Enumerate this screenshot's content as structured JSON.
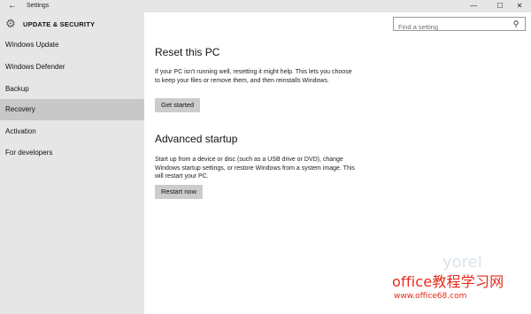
{
  "window": {
    "back_icon": "←",
    "title": "Settings",
    "min_icon": "—",
    "max_icon": "☐",
    "close_icon": "✕"
  },
  "sidebar": {
    "section_title": "UPDATE & SECURITY",
    "gear_icon": "⚙",
    "items": [
      {
        "label": "Windows Update",
        "selected": false
      },
      {
        "label": "Windows Defender",
        "selected": false
      },
      {
        "label": "Backup",
        "selected": false
      },
      {
        "label": "Recovery",
        "selected": true
      },
      {
        "label": "Activation",
        "selected": false
      },
      {
        "label": "For developers",
        "selected": false
      }
    ]
  },
  "search": {
    "placeholder": "Find a setting",
    "icon": "⚲"
  },
  "main": {
    "reset": {
      "heading": "Reset this PC",
      "body": "If your PC isn't running well, resetting it might help. This lets you choose to keep your files or remove them, and then reinstalls Windows.",
      "button": "Get started"
    },
    "advanced": {
      "heading": "Advanced startup",
      "body": "Start up from a device or disc (such as a USB drive or DVD), change Windows startup settings, or restore Windows from a system image. This will restart your PC.",
      "button": "Restart now"
    }
  },
  "watermark": {
    "line1": "office教程学习网",
    "line2": "www.office68.com",
    "ghost": "yorel"
  },
  "colors": {
    "sidebar_bg": "#e6e6e6",
    "selected_bg": "#c8c8c8",
    "button_bg": "#cccccc",
    "watermark": "#e8291b"
  }
}
